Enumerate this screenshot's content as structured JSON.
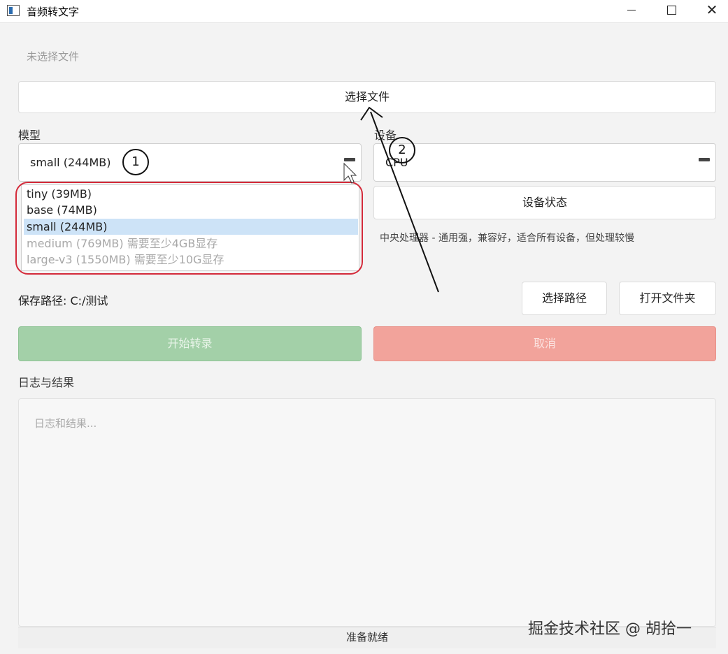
{
  "window": {
    "title": "音频转文字",
    "minimize": "",
    "maximize": "",
    "close": "✕"
  },
  "file": {
    "status": "未选择文件",
    "select_button": "选择文件"
  },
  "model": {
    "label": "模型",
    "selected": "small (244MB)",
    "options": [
      {
        "label": "tiny (39MB)",
        "enabled": true,
        "selected": false
      },
      {
        "label": "base (74MB)",
        "enabled": true,
        "selected": false
      },
      {
        "label": "small (244MB)",
        "enabled": true,
        "selected": true
      },
      {
        "label": "medium (769MB) 需要至少4GB显存",
        "enabled": false,
        "selected": false
      },
      {
        "label": "large-v3 (1550MB) 需要至少10G显存",
        "enabled": false,
        "selected": false
      }
    ]
  },
  "device": {
    "label": "设备",
    "selected": "CPU",
    "status_button": "设备状态",
    "description": "中央处理器 - 通用强，兼容好，适合所有设备，但处理较慢"
  },
  "save": {
    "path_text": "保存路径: C:/测试",
    "choose_path_button": "选择路径",
    "open_folder_button": "打开文件夹"
  },
  "actions": {
    "start_button": "开始转录",
    "cancel_button": "取消"
  },
  "log": {
    "label": "日志与结果",
    "placeholder": "日志和结果..."
  },
  "status_bar": {
    "text": "准备就绪"
  },
  "annotations": {
    "marker_1": "1",
    "marker_2": "2",
    "color": "#d42a3a"
  },
  "watermark": "掘金技术社区 @ 胡拾一"
}
